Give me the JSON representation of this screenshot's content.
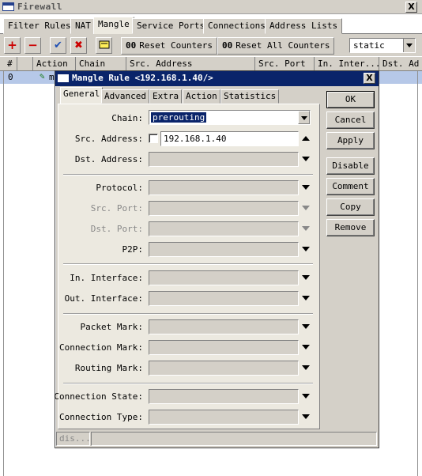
{
  "window": {
    "title": "Firewall",
    "close_label": "X"
  },
  "outer_tabs": [
    {
      "label": "Filter Rules"
    },
    {
      "label": "NAT"
    },
    {
      "label": "Mangle",
      "active": true
    },
    {
      "label": "Service Ports"
    },
    {
      "label": "Connections"
    },
    {
      "label": "Address Lists"
    }
  ],
  "toolbar": {
    "add_icon": "+",
    "remove_icon": "−",
    "enable_icon": "✔",
    "disable_icon": "✖",
    "comment_icon": "comment-icon",
    "counter_prefix": "00",
    "reset_counters_label": "Reset Counters",
    "reset_all_counters_label": "Reset All Counters",
    "filter_value": "static"
  },
  "grid": {
    "columns": [
      "#",
      "",
      "Action",
      "Chain",
      "Src. Address",
      "Src. Port",
      "In. Inter...",
      "Dst. Ad"
    ],
    "first_row_marker": "0",
    "first_row_text": "m"
  },
  "dialog": {
    "title": "Mangle Rule <192.168.1.40/>",
    "close_label": "X",
    "tabs": [
      "General",
      "Advanced",
      "Extra",
      "Action",
      "Statistics"
    ],
    "active_tab": "General",
    "fields": {
      "chain_label": "Chain:",
      "chain_value": "prerouting",
      "src_address_label": "Src. Address:",
      "src_address_value": "192.168.1.40",
      "dst_address_label": "Dst. Address:",
      "protocol_label": "Protocol:",
      "src_port_label": "Src. Port:",
      "dst_port_label": "Dst. Port:",
      "p2p_label": "P2P:",
      "in_interface_label": "In. Interface:",
      "out_interface_label": "Out. Interface:",
      "packet_mark_label": "Packet Mark:",
      "connection_mark_label": "Connection Mark:",
      "routing_mark_label": "Routing Mark:",
      "connection_state_label": "Connection State:",
      "connection_type_label": "Connection Type:"
    },
    "buttons": {
      "ok": "OK",
      "cancel": "Cancel",
      "apply": "Apply",
      "disable": "Disable",
      "comment": "Comment",
      "copy": "Copy",
      "remove": "Remove"
    },
    "status": "dis..."
  },
  "colors": {
    "title_bar_active": "#0a246a",
    "window_face": "#d4d0c8",
    "selected_row": "#b6c8e8",
    "add_icon": "#cc0000",
    "remove_icon": "#cc0000",
    "enable_icon": "#1f4fb4",
    "disable_icon": "#cc0000"
  }
}
